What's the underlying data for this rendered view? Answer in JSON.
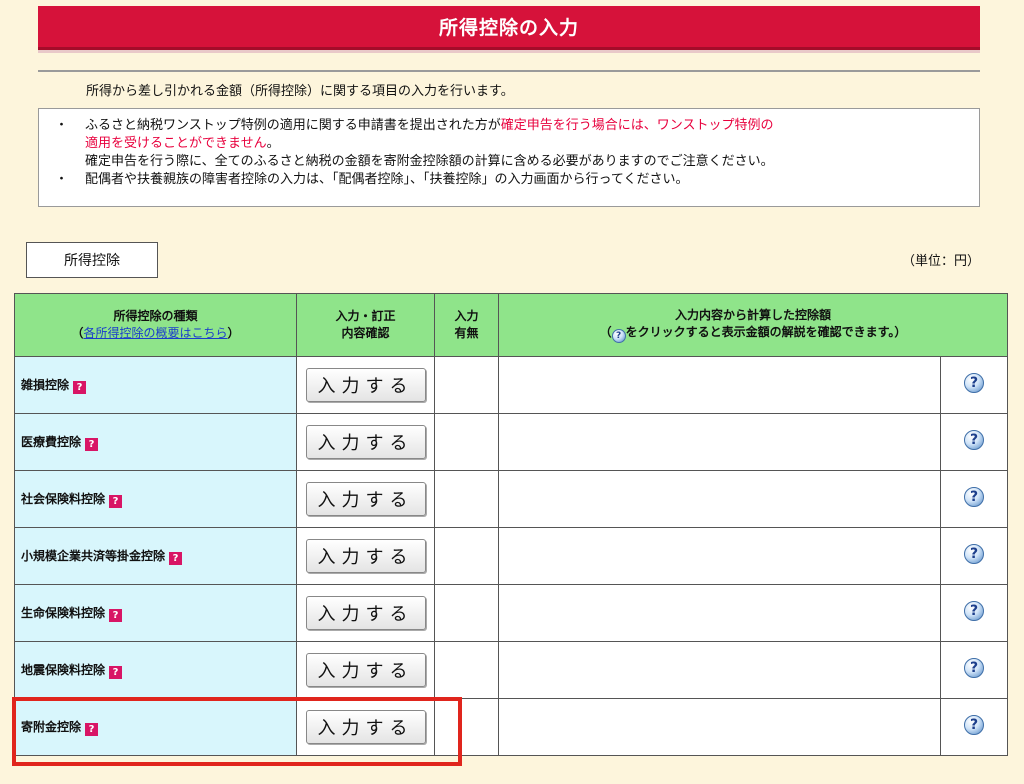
{
  "title": "所得控除の入力",
  "intro": "所得から差し引かれる金額（所得控除）に関する項目の入力を行います。",
  "notice": {
    "bullet": "・",
    "line1_normal": "ふるさと納税ワンストップ特例の適用に関する申請書を提出された方が",
    "line1_red": "確定申告を行う場合には、ワンストップ特例の",
    "line2_red": "適用を受けることができません",
    "line2_end": "。",
    "line3": "確定申告を行う際に、全てのふるさと納税の金額を寄附金控除額の計算に含める必要がありますのでご注意ください。",
    "line4": "配偶者や扶養親族の障害者控除の入力は、「配偶者控除」、「扶養控除」の入力画面から行ってください。"
  },
  "section_label": "所得控除",
  "unit": "（単位：円）",
  "table": {
    "headers": {
      "type_title": "所得控除の種類",
      "type_link": "各所得控除の概要はこちら",
      "type_paren_open": "（",
      "type_paren_close": "）",
      "input_line1": "入力・訂正",
      "input_line2": "内容確認",
      "has_line1": "入力",
      "has_line2": "有無",
      "calc_line1": "入力内容から計算した控除額",
      "calc_line2_pre": "（",
      "calc_line2_icon": "?",
      "calc_line2_post": "をクリックすると表示金額の解説を確認できます。）"
    },
    "help_badge": "?",
    "button_label": "入力する",
    "q_mark": "?",
    "rows": [
      {
        "name": "雑損控除"
      },
      {
        "name": "医療費控除"
      },
      {
        "name": "社会保険料控除"
      },
      {
        "name": "小規模企業共済等掛金控除"
      },
      {
        "name": "生命保険料控除"
      },
      {
        "name": "地震保険料控除"
      },
      {
        "name": "寄附金控除"
      }
    ]
  },
  "colors": {
    "title_bg": "#d6123a",
    "header_bg": "#8fe48a",
    "name_cell_bg": "#d8f6fc",
    "highlight": "#e0251d",
    "notice_red": "#e8003d"
  }
}
